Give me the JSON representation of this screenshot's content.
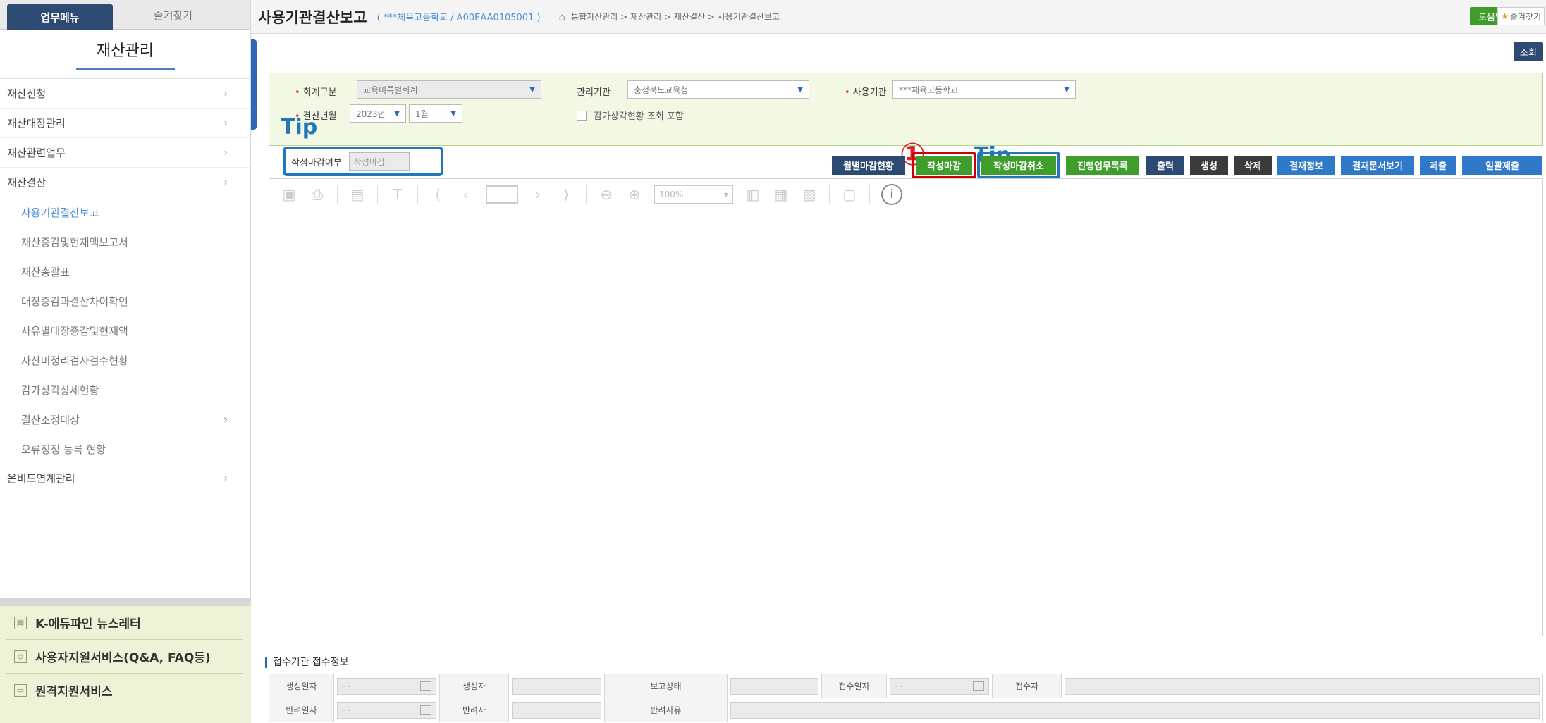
{
  "sidebar": {
    "tabs": [
      "업무메뉴",
      "즐겨찾기"
    ],
    "title": "재산관리",
    "menu": [
      {
        "label": "재산신청",
        "has_arrow": true
      },
      {
        "label": "재산대장관리",
        "has_arrow": true
      },
      {
        "label": "재산관련업무",
        "has_arrow": true
      },
      {
        "label": "재산결산",
        "has_arrow": true
      }
    ],
    "submenu": [
      {
        "label": "사용기관결산보고",
        "active": true
      },
      {
        "label": "재산증감및현재액보고서"
      },
      {
        "label": "재산총괄표"
      },
      {
        "label": "대장증감과결산차이확인"
      },
      {
        "label": "사유별대장증감및현재액"
      },
      {
        "label": "자산미정리검사검수현황"
      },
      {
        "label": "감가상각상세현황"
      },
      {
        "label": "결산조정대상",
        "has_arrow": true
      },
      {
        "label": "오류정정 등록 현황"
      }
    ],
    "menu_after": {
      "label": "온비드연계관리",
      "has_arrow": true
    },
    "services": [
      "K-에듀파인 뉴스레터",
      "사용자지원서비스(Q&A, FAQ등)",
      "원격지원서비스"
    ]
  },
  "header": {
    "title": "사용기관결산보고",
    "subtitle": "( ***체육고등학교 / A00EAA0105001 )",
    "breadcrumb": "통합자산관리 > 재산관리 > 재산결산 > 사용기관결산보고",
    "help_label": "도움말",
    "fav_label": "즐겨찾기"
  },
  "search_label": "조회",
  "filters": {
    "account_label": "회계구분",
    "account_value": "교육비특별회계",
    "agency_label": "관리기관",
    "agency_value": "충청북도교육청",
    "user_org_label": "사용기관",
    "user_org_value": "***체육고등학교",
    "period_label": "결산년월",
    "year_value": "2023년",
    "month_value": "1월",
    "depreciation_label": "감가상각현황 조회 포함"
  },
  "annotations": {
    "tip_left": "Tip",
    "tip_right": "Tip",
    "marker": "①"
  },
  "status": {
    "label": "작성마감여부",
    "value": "작성마감"
  },
  "actions": [
    {
      "label": "월별마감현황",
      "color": "navy"
    },
    {
      "label": "작성마감",
      "color": "green"
    },
    {
      "label": "작성마감취소",
      "color": "green"
    },
    {
      "label": "진행업무목록",
      "color": "green"
    },
    {
      "label": "출력",
      "color": "navy"
    },
    {
      "label": "생성",
      "color": "dark"
    },
    {
      "label": "삭제",
      "color": "dark"
    },
    {
      "label": "결재정보",
      "color": "blue"
    },
    {
      "label": "결재문서보기",
      "color": "blue"
    },
    {
      "label": "제출",
      "color": "blue"
    },
    {
      "label": "일괄제출",
      "color": "blue"
    }
  ],
  "viewer": {
    "zoom": "100%"
  },
  "reception": {
    "title": "접수기관 접수정보",
    "date_placeholder": "- -",
    "row1": [
      "생성일자",
      "생성자",
      "보고상태",
      "접수일자",
      "접수자"
    ],
    "row2": [
      "반려일자",
      "반려자",
      "반려사유"
    ]
  },
  "colors": {
    "navy": "#2d4a73",
    "green": "#3f9d2c",
    "blue": "#2f79c8",
    "highlight_red": "#cc0000",
    "highlight_blue": "#2277bb"
  }
}
